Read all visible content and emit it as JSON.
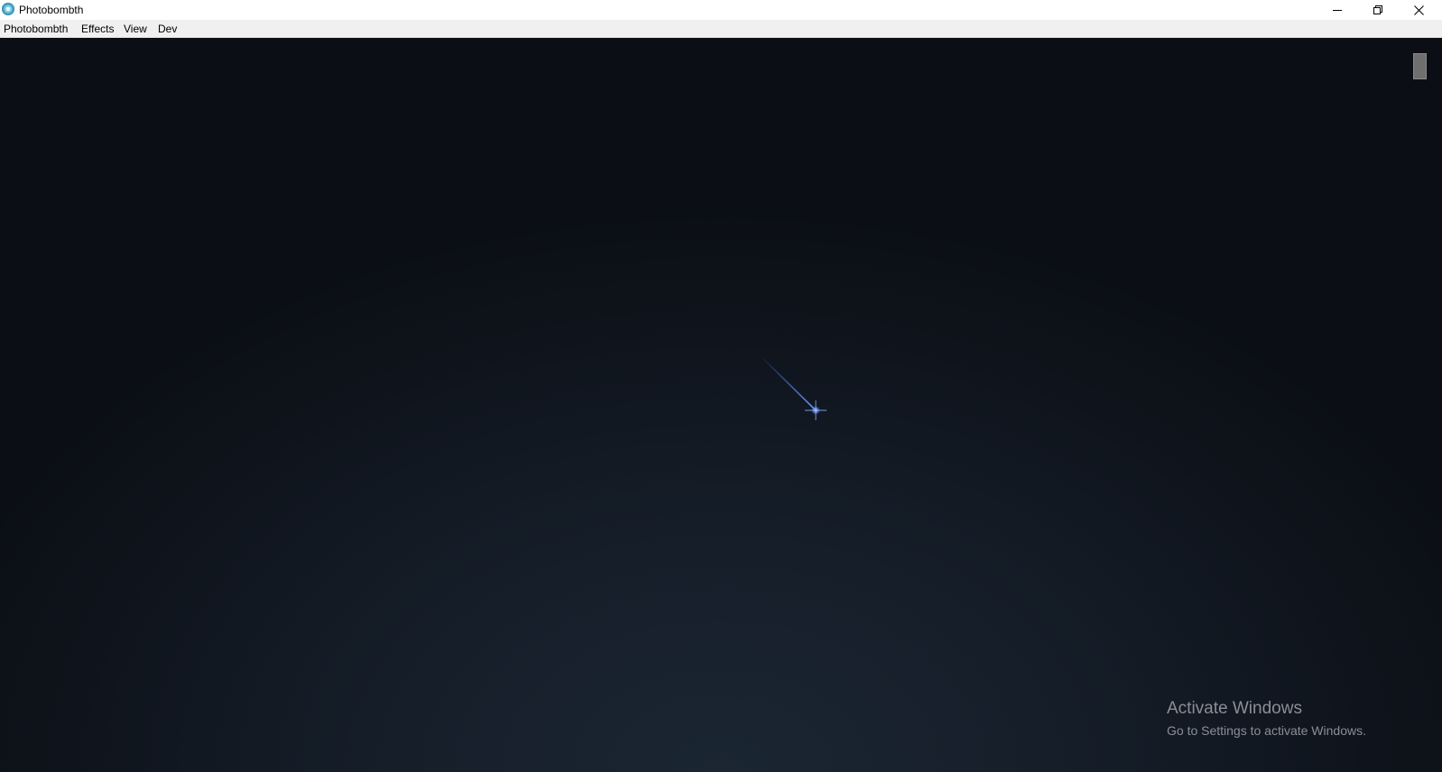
{
  "window": {
    "title": "Photobombth",
    "icon": "app-icon",
    "controls": {
      "minimize_icon": "minimize-icon",
      "restore_icon": "restore-icon",
      "close_icon": "close-icon"
    }
  },
  "menu": {
    "items": [
      {
        "label": "Photobombth"
      },
      {
        "label": "Effects"
      },
      {
        "label": "View"
      },
      {
        "label": "Dev"
      }
    ]
  },
  "canvas": {
    "background_color": "#0f141c",
    "glow_color": "#1b2633",
    "comet_color": "#4a7dff",
    "comet_icon": "shooting-star-icon"
  },
  "watermark": {
    "title": "Activate Windows",
    "subtitle": "Go to Settings to activate Windows."
  }
}
